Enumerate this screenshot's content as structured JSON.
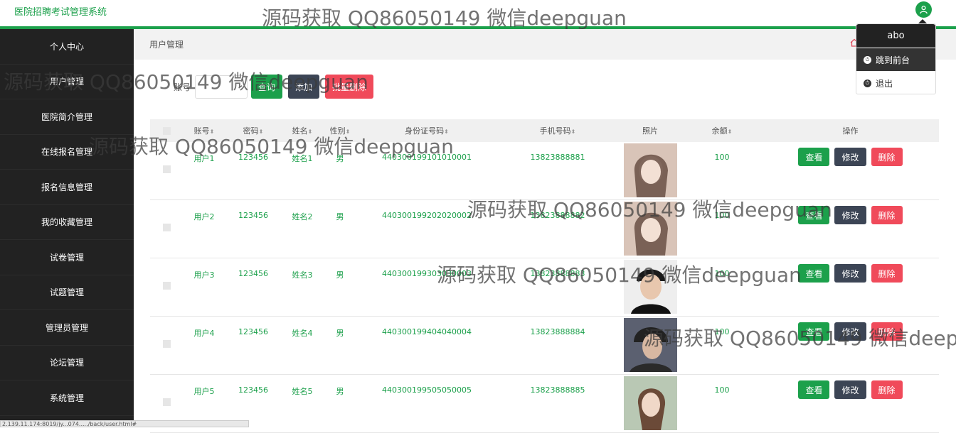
{
  "app": {
    "title": "医院招聘考试管理系统"
  },
  "colors": {
    "accent": "#1ca04b",
    "sidebar_bg": "#222222",
    "danger": "#f04a5a",
    "dark_button": "#3c4555"
  },
  "user_menu": {
    "username": "abo",
    "front_label": "跳到前台",
    "logout_label": "退出"
  },
  "sidebar": {
    "items": [
      {
        "label": "个人中心"
      },
      {
        "label": "用户管理"
      },
      {
        "label": "医院简介管理"
      },
      {
        "label": "在线报名管理"
      },
      {
        "label": "报名信息管理"
      },
      {
        "label": "我的收藏管理"
      },
      {
        "label": "试卷管理"
      },
      {
        "label": "试题管理"
      },
      {
        "label": "管理员管理"
      },
      {
        "label": "论坛管理"
      },
      {
        "label": "系统管理"
      }
    ]
  },
  "breadcrumb": {
    "current": "用户管理"
  },
  "search": {
    "label": "账号",
    "value": "",
    "query_label": "查询",
    "add_label": "添加",
    "batch_delete_label": "批量删除"
  },
  "table": {
    "headers": {
      "account": "账号",
      "password": "密码",
      "name": "姓名",
      "gender": "性别",
      "id_card": "身份证号码",
      "phone": "手机号码",
      "photo": "照片",
      "balance": "余额",
      "actions": "操作"
    },
    "action_labels": {
      "view": "查看",
      "edit": "修改",
      "delete": "删除"
    },
    "rows": [
      {
        "account": "用户1",
        "password": "123456",
        "name": "姓名1",
        "gender": "男",
        "id_card": "440300199101010001",
        "phone": "13823888881",
        "balance": "100"
      },
      {
        "account": "用户2",
        "password": "123456",
        "name": "姓名2",
        "gender": "男",
        "id_card": "440300199202020002",
        "phone": "13823888882",
        "balance": "100"
      },
      {
        "account": "用户3",
        "password": "123456",
        "name": "姓名3",
        "gender": "男",
        "id_card": "440300199303030003",
        "phone": "13823888883",
        "balance": "100"
      },
      {
        "account": "用户4",
        "password": "123456",
        "name": "姓名4",
        "gender": "男",
        "id_card": "440300199404040004",
        "phone": "13823888884",
        "balance": "100"
      },
      {
        "account": "用户5",
        "password": "123456",
        "name": "姓名5",
        "gender": "男",
        "id_card": "440300199505050005",
        "phone": "13823888885",
        "balance": "100"
      }
    ]
  },
  "watermark": {
    "text": "源码获取 QQ86050149 微信deepguan"
  },
  "status_bar": {
    "url": "2.139.11.174:8019/jy...074...../back/user.html#"
  }
}
